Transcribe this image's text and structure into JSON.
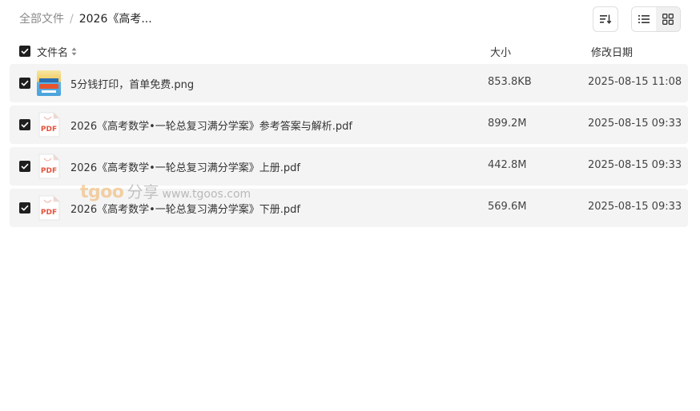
{
  "breadcrumb": {
    "root": "全部文件",
    "separator": "/",
    "current": "2026《高考..."
  },
  "toolbar": {
    "sort_icon": "sort-lines-icon",
    "list_view_icon": "list-view-icon",
    "grid_view_icon": "grid-view-icon"
  },
  "columns": {
    "name": "文件名",
    "size": "大小",
    "date": "修改日期"
  },
  "files": [
    {
      "name": "5分钱打印，首单免费.png",
      "size": "853.8KB",
      "date": "2025-08-15 11:08",
      "type": "image"
    },
    {
      "name": "2026《高考数学•一轮总复习满分学案》参考答案与解析.pdf",
      "size": "899.2M",
      "date": "2025-08-15 09:33",
      "type": "pdf"
    },
    {
      "name": "2026《高考数学•一轮总复习满分学案》上册.pdf",
      "size": "442.8M",
      "date": "2025-08-15 09:33",
      "type": "pdf"
    },
    {
      "name": "2026《高考数学•一轮总复习满分学案》下册.pdf",
      "size": "569.6M",
      "date": "2025-08-15 09:33",
      "type": "pdf"
    }
  ],
  "pdf_label": "PDF",
  "watermark": {
    "brand": "tgoo",
    "cn": "分享",
    "url": "www.tgoos.com"
  },
  "colors": {
    "row_bg": "#f4f4f4",
    "checkbox": "#1f1f1f",
    "pdf_red": "#e5533d"
  }
}
